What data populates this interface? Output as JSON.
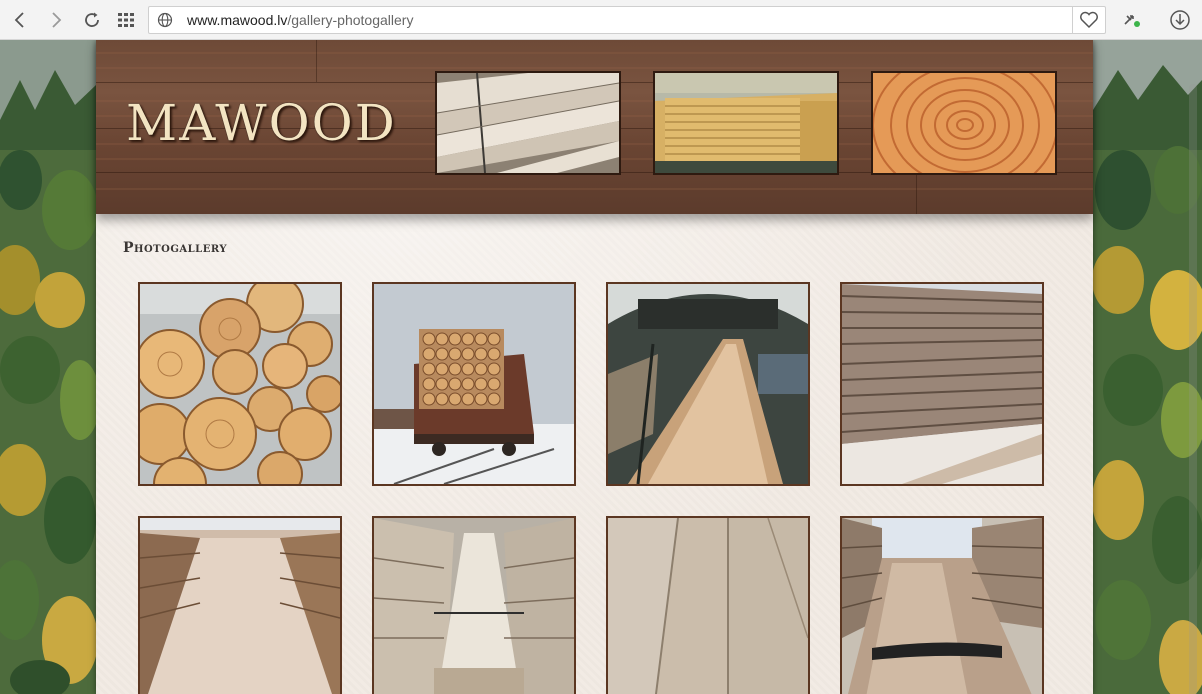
{
  "browser": {
    "url_host": "www.mawood.lv",
    "url_path": "/gallery-photogallery",
    "icons": [
      "back-icon",
      "forward-icon",
      "reload-icon",
      "speed-dial-icon",
      "globe-icon",
      "heart-icon",
      "extension-icon",
      "download-icon"
    ]
  },
  "header": {
    "logo_text": "MAWOOD",
    "photos": [
      {
        "name": "header-photo-planks"
      },
      {
        "name": "header-photo-lumber-stacks"
      },
      {
        "name": "header-photo-tree-rings"
      }
    ]
  },
  "gallery": {
    "title": "Photogallery",
    "thumbnails": [
      {
        "name": "gallery-photo-log-ends"
      },
      {
        "name": "gallery-photo-rail-wagon-logs"
      },
      {
        "name": "gallery-photo-sawmill-log"
      },
      {
        "name": "gallery-photo-stacked-boards"
      },
      {
        "name": "gallery-photo-board-aisle"
      },
      {
        "name": "gallery-photo-strapped-bundle"
      },
      {
        "name": "gallery-photo-plank-closeup"
      },
      {
        "name": "gallery-photo-snowy-stacks"
      }
    ]
  }
}
